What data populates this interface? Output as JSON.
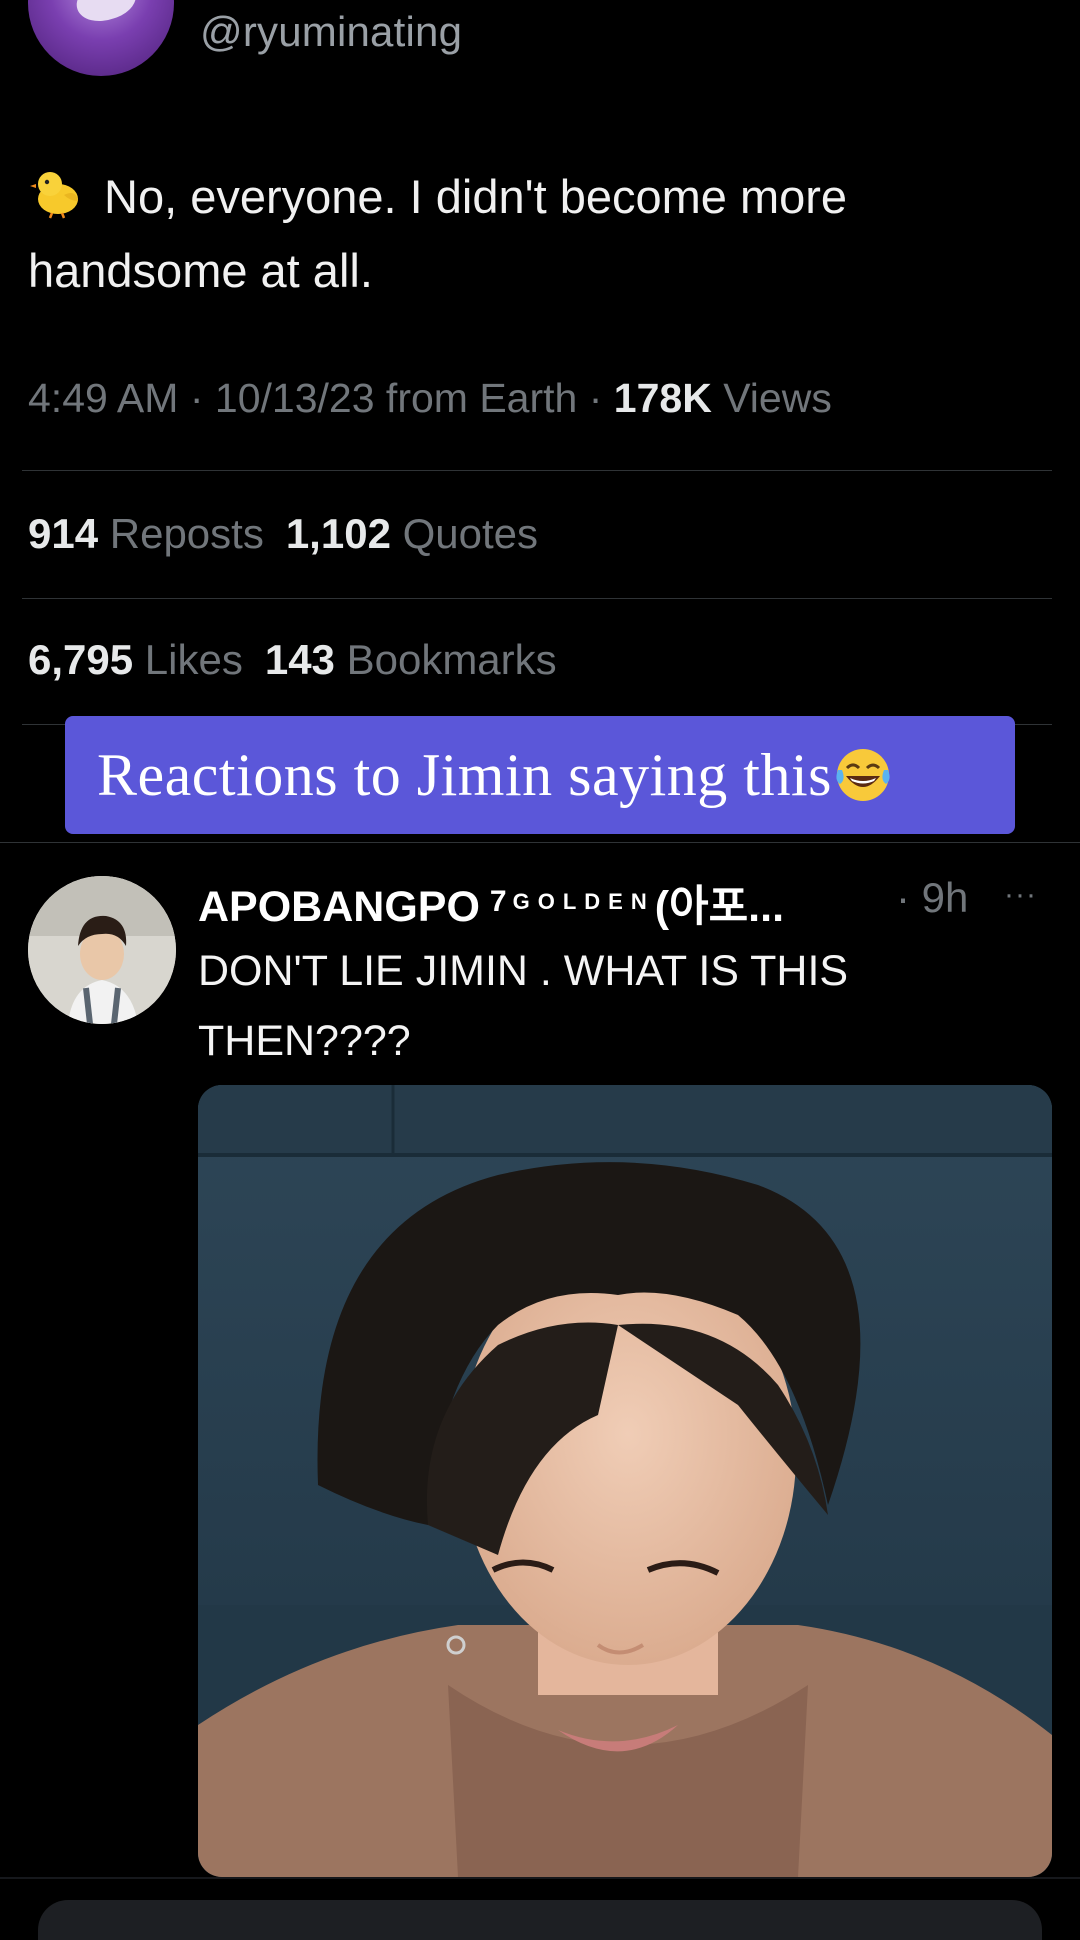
{
  "tweet": {
    "handle": "@ryuminating",
    "text": "No, everyone. I didn't become more handsome at all.",
    "time": "4:49 AM",
    "date": "10/13/23",
    "location": "from Earth",
    "views_count": "178K",
    "views_label": "Views",
    "sep": "·",
    "reposts_count": "914",
    "reposts_label": "Reposts",
    "quotes_count": "1,102",
    "quotes_label": "Quotes",
    "likes_count": "6,795",
    "likes_label": "Likes",
    "bookmarks_count": "143",
    "bookmarks_label": "Bookmarks",
    "icon": "chick-emoji"
  },
  "banner": {
    "text": "Reactions to Jimin saying this",
    "icon": "laughing-tears-emoji",
    "color": "#5b57d9"
  },
  "reply": {
    "name": "APOBANGPO",
    "name_sup": "7",
    "name_badge": "GOLDEN",
    "name_suffix": "(아포...",
    "time": "· 9h",
    "more": "···",
    "text": "DON'T LIE JIMIN . WHAT IS THIS THEN????"
  },
  "colors": {
    "background": "#000000",
    "muted_text": "#71767b",
    "primary_text": "#e7e9ea",
    "divider": "#2f3336"
  }
}
